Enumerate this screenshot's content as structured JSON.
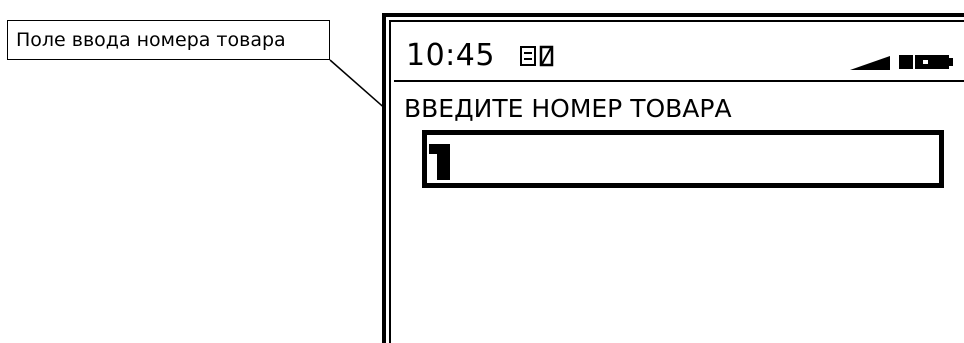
{
  "callout": {
    "label": "Поле ввода номера товара"
  },
  "device": {
    "status_bar": {
      "time": "10:45",
      "indicator_icon": "document-zero-icon",
      "signal_icon": "signal-strength-icon",
      "battery_icon": "battery-icon"
    },
    "prompt": "ВВЕДИТЕ НОМЕР ТОВАРА",
    "number_field": {
      "value": "",
      "cursor_icon": "block-cursor-icon"
    }
  }
}
